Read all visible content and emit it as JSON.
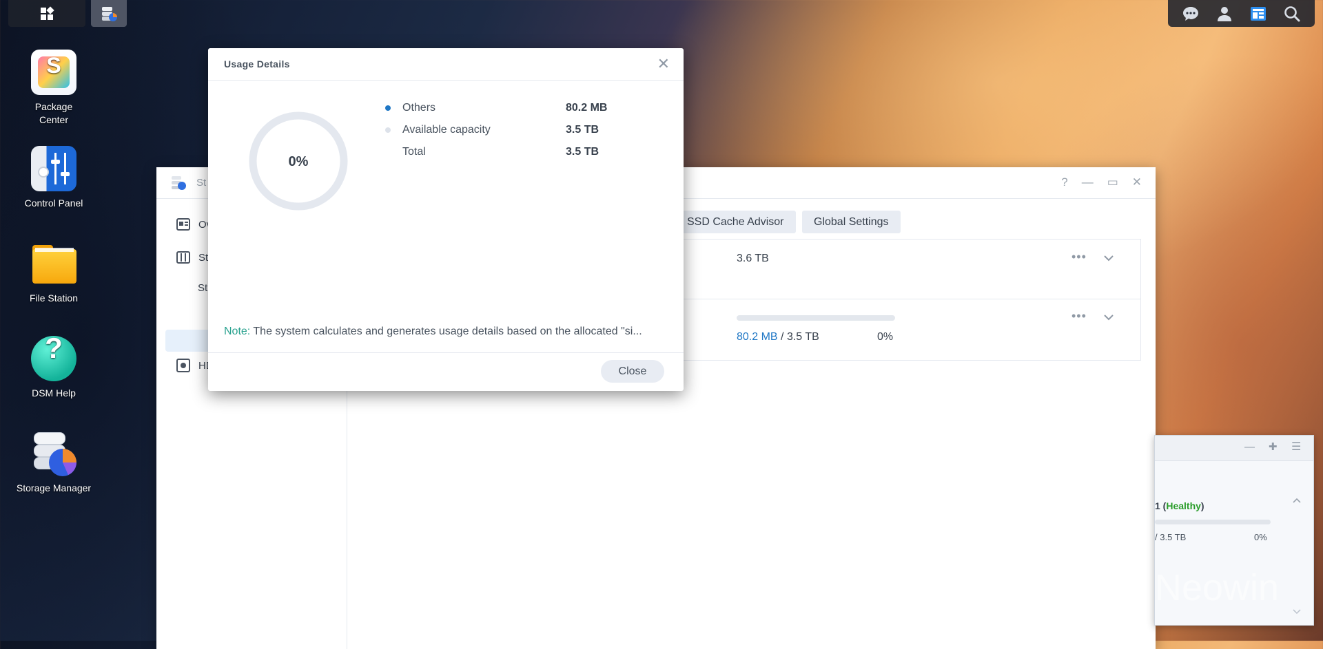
{
  "desktop": {
    "icons": [
      {
        "label": "Package Center",
        "icon": "package-center-icon"
      },
      {
        "label": "Control Panel",
        "icon": "control-panel-icon"
      },
      {
        "label": "File Station",
        "icon": "folder-icon"
      },
      {
        "label": "DSM Help",
        "icon": "help-icon"
      },
      {
        "label": "Storage Manager",
        "icon": "storage-manager-icon"
      }
    ],
    "watermark": "Neowin"
  },
  "taskbar": {
    "left": [
      "main-menu-icon",
      "storage-manager-icon"
    ],
    "tray": [
      "chat-icon",
      "user-icon",
      "widgets-icon",
      "search-icon"
    ]
  },
  "storage_manager": {
    "title_fragment": "St",
    "sidebar": [
      {
        "label": "Ov",
        "icon": "overview-icon"
      },
      {
        "label": "St",
        "icon": "storage-icon"
      },
      {
        "label": "St",
        "icon": ""
      },
      {
        "label": "HD",
        "icon": "hdd-icon"
      }
    ],
    "tabs": [
      "SSD Cache Advisor",
      "Global Settings"
    ],
    "pool": {
      "size": "3.6 TB"
    },
    "volume": {
      "used": "80.2 MB",
      "separator": " / ",
      "total": "3.5 TB",
      "percent": "0%",
      "fill_fraction": 0.0
    }
  },
  "widget": {
    "status_prefix": "1 (",
    "status": "Healthy",
    "status_suffix": ")",
    "capacity": "/ 3.5 TB",
    "percent": "0%"
  },
  "modal": {
    "title": "Usage Details",
    "donut_percent": "0%",
    "legend": [
      {
        "label": "Others",
        "value": "80.2 MB",
        "color": "#1f77c5"
      },
      {
        "label": "Available capacity",
        "value": "3.5 TB",
        "color": "#dde2ea"
      },
      {
        "label": "Total",
        "value": "3.5 TB",
        "color": ""
      }
    ],
    "note_label": "Note:",
    "note_text": " The system calculates and generates usage details based on the allocated \"si...",
    "close_label": "Close"
  },
  "colors": {
    "accent": "#1f77c5",
    "healthy": "#2a9d2a",
    "note": "#2aa28f"
  }
}
